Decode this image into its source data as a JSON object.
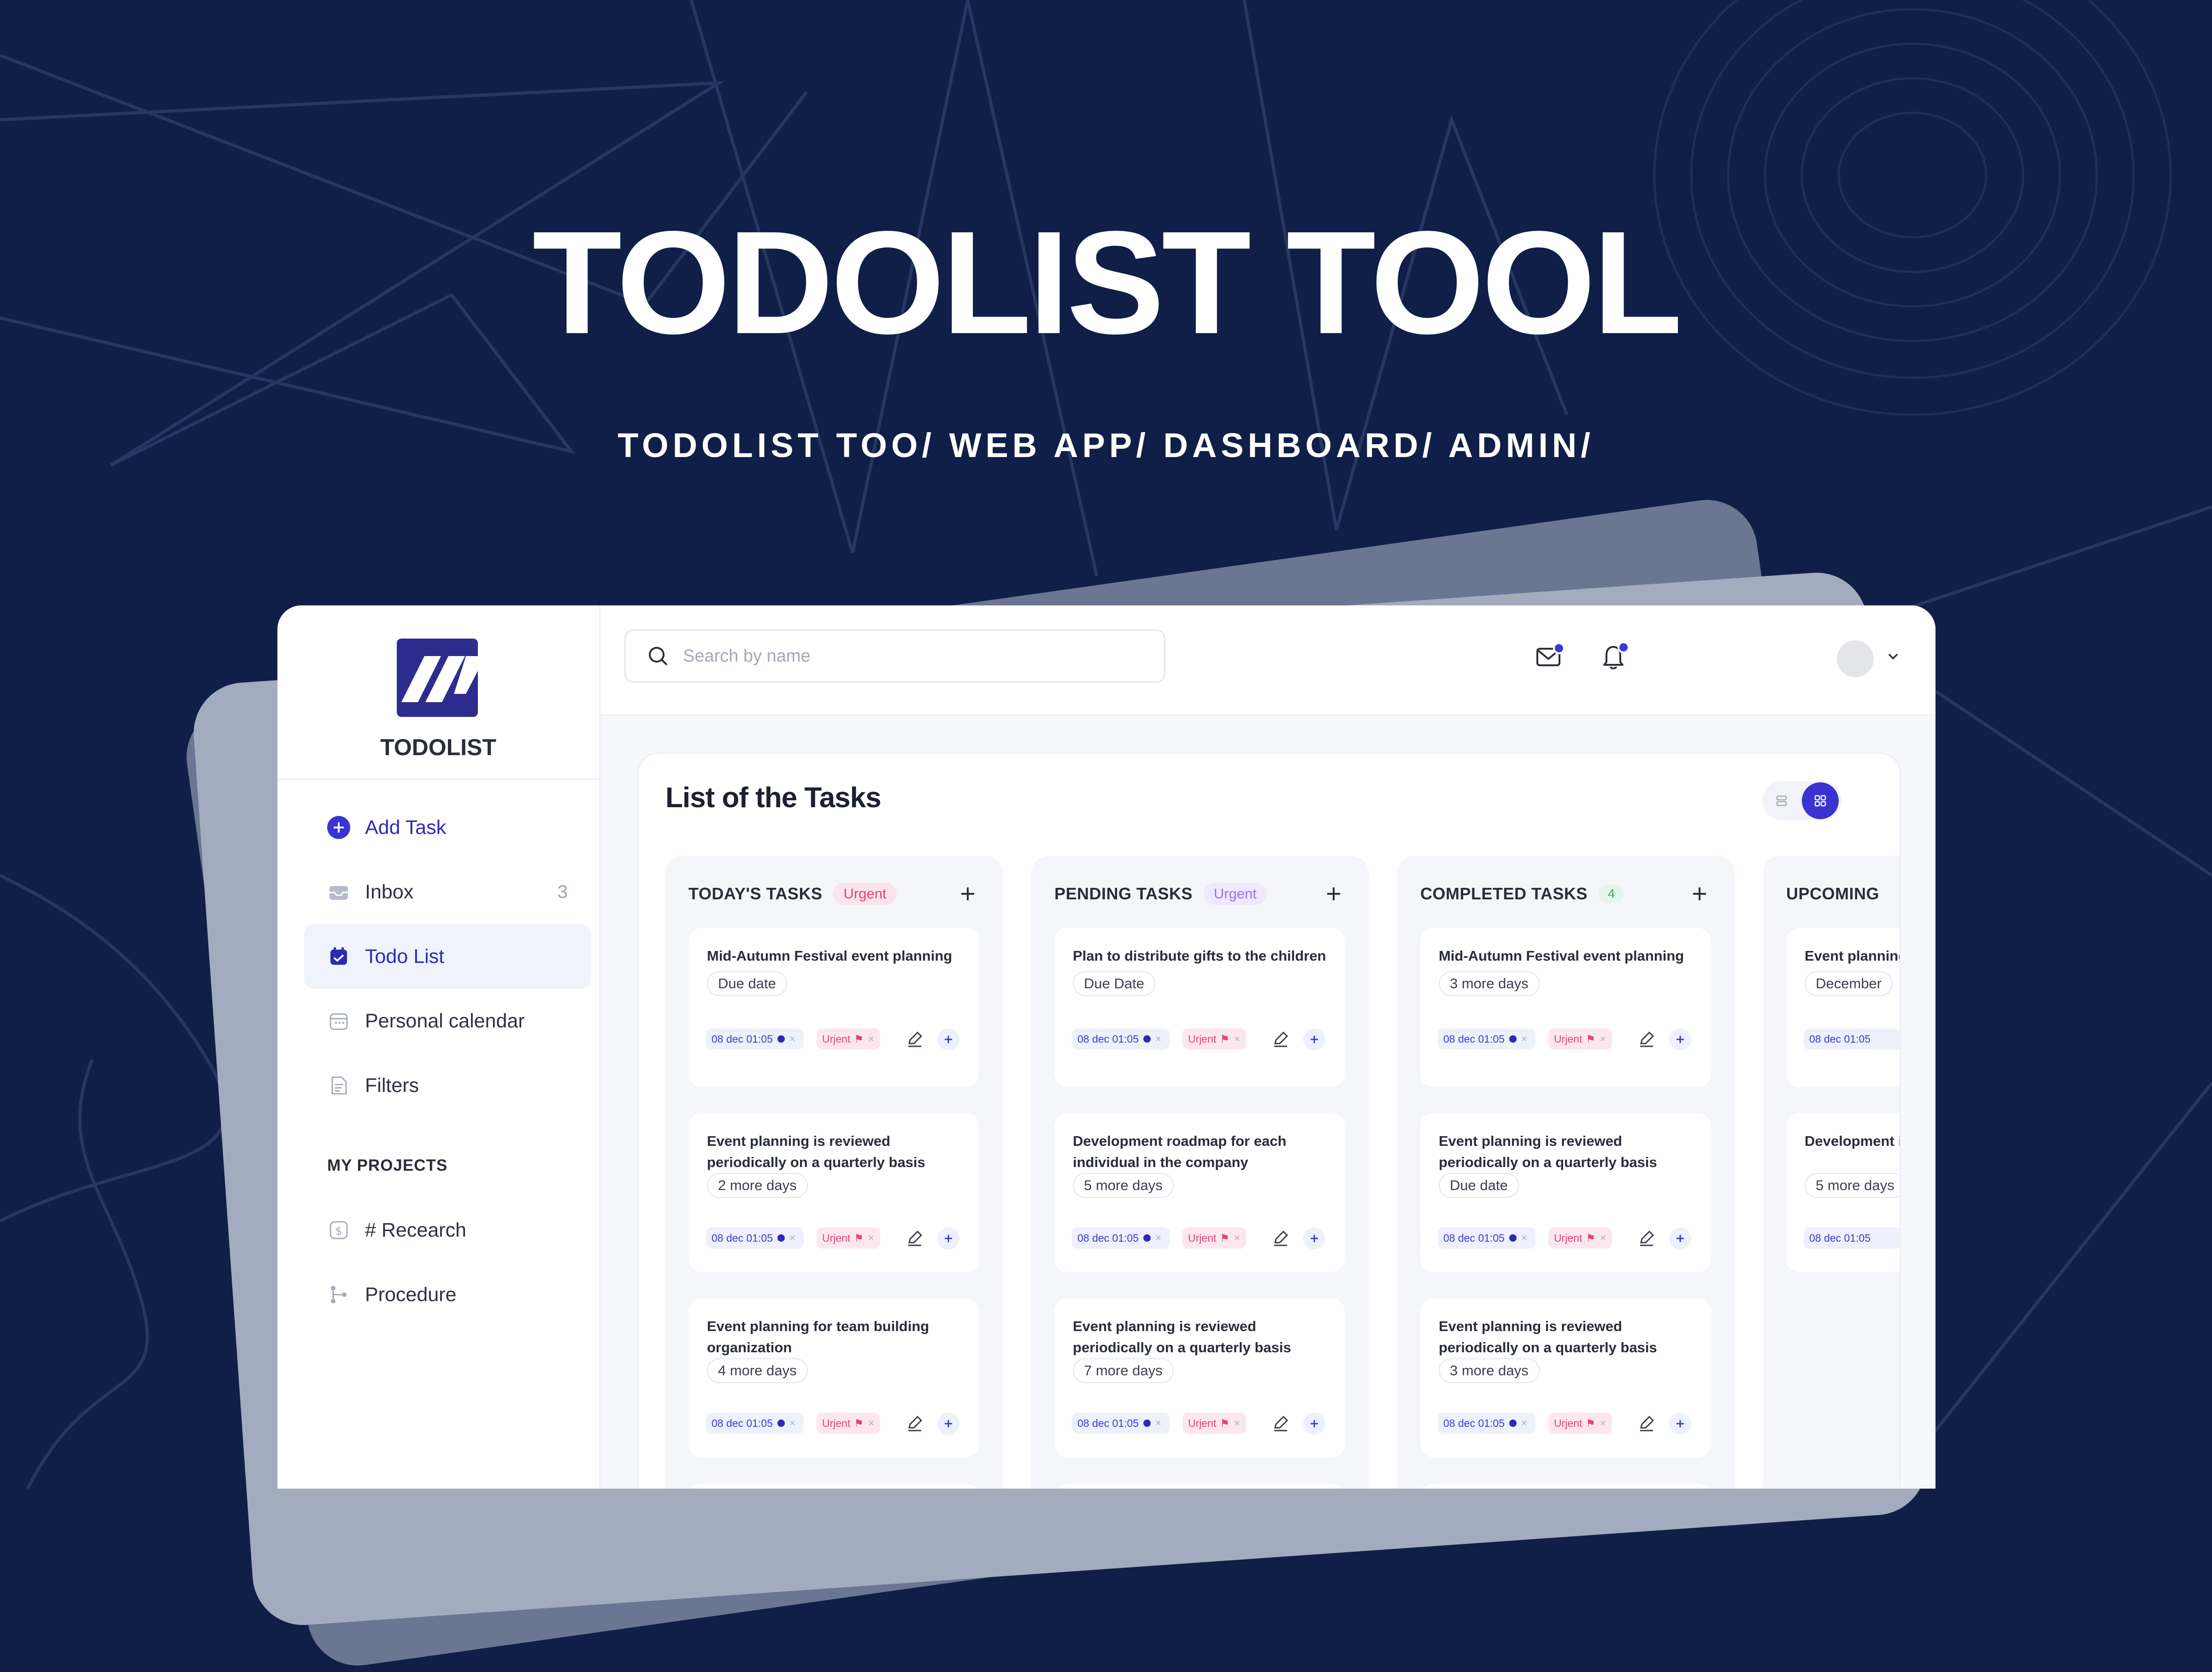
{
  "hero": {
    "title": "TODOLIST TOOL",
    "subtitle": "TODOLIST TOO/ WEB APP/ DASHBOARD/ ADMIN/"
  },
  "colors": {
    "background": "#0f1f47",
    "accent": "#3a33d1",
    "urgent": "#e0457a",
    "logo": "#2e2c8f"
  },
  "brand": {
    "logo_icon": "todolist-logo-icon",
    "name": "TODOLIST"
  },
  "sidebar": {
    "add_task": {
      "label": "Add Task",
      "icon": "plus-circle-icon"
    },
    "items": [
      {
        "label": "Inbox",
        "count": "3",
        "icon": "inbox-icon"
      },
      {
        "label": "Todo List",
        "icon": "calendar-check-icon",
        "active": true
      },
      {
        "label": "Personal calendar",
        "icon": "calendar-icon"
      },
      {
        "label": "Filters",
        "icon": "filter-icon"
      }
    ],
    "projects_heading": "MY PROJECTS",
    "projects": [
      {
        "label": "# Recearch",
        "icon": "dollar-icon"
      },
      {
        "label": "Procedure",
        "icon": "flow-icon"
      }
    ]
  },
  "topbar": {
    "search_placeholder": "Search by name",
    "icons": [
      "mail-icon",
      "bell-icon",
      "avatar",
      "chevron-down-icon"
    ]
  },
  "panel": {
    "title": "List of the Tasks",
    "view_toggle": [
      "list-view-icon",
      "grid-view-icon"
    ],
    "columns": [
      {
        "title": "TODAY'S TASKS",
        "badge": "Urgent",
        "cards": [
          {
            "title": "Mid-Autumn Festival event planning",
            "due": "Due date",
            "date": "08 dec 01:05",
            "tag": "Urjent"
          },
          {
            "title": "Event planning is reviewed periodically on a quarterly basis",
            "due": "2 more days",
            "date": "08 dec 01:05",
            "tag": "Urjent"
          },
          {
            "title": "Event planning for team building organization",
            "due": "4 more days",
            "date": "08 dec 01:05",
            "tag": "Urjent"
          }
        ]
      },
      {
        "title": "PENDING TASKS",
        "badge": "Urgent",
        "cards": [
          {
            "title": "Plan to distribute gifts to the children",
            "due": "Due Date",
            "date": "08 dec 01:05",
            "tag": "Urjent"
          },
          {
            "title": "Development roadmap for each individual in the company",
            "due": "5 more days",
            "date": "08 dec 01:05",
            "tag": "Urjent"
          },
          {
            "title": "Event planning is reviewed periodically on a quarterly basis",
            "due": "7 more days",
            "date": "08 dec 01:05",
            "tag": "Urjent"
          }
        ]
      },
      {
        "title": "COMPLETED TASKS",
        "badge": "4",
        "cards": [
          {
            "title": "Mid-Autumn Festival event planning",
            "due": "3 more days",
            "date": "08 dec 01:05",
            "tag": "Urjent"
          },
          {
            "title": "Event planning is reviewed periodically on a quarterly basis",
            "due": "Due date",
            "date": "08 dec 01:05",
            "tag": "Urjent"
          },
          {
            "title": "Event planning is reviewed periodically on a quarterly basis",
            "due": "3  more days",
            "date": "08 dec 01:05",
            "tag": "Urjent"
          }
        ]
      },
      {
        "title": "UPCOMING",
        "cards": [
          {
            "title": "Event planning",
            "due": "December",
            "date": "08 dec 01:05"
          },
          {
            "title": "Development individual",
            "due": "5 more days",
            "date": "08 dec 01:05"
          }
        ]
      }
    ]
  }
}
